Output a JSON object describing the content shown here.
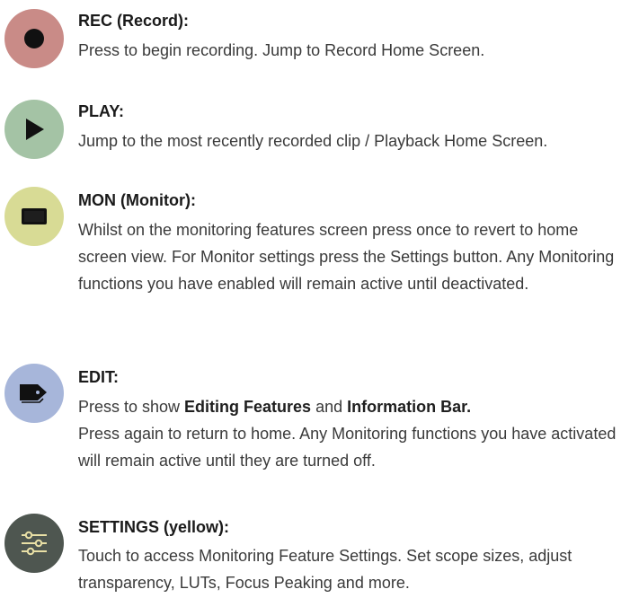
{
  "colors": {
    "rec_button": "#c98b87",
    "play_button": "#a4c3a5",
    "mon_button": "#d8db95",
    "edit_button": "#a7b6da",
    "settings_button": "#4e5650",
    "icon_dark": "#111111",
    "icon_light": "#e9e0a6"
  },
  "items": [
    {
      "icon": "record-icon",
      "title": "REC (Record):",
      "lines": [
        "Press to begin recording. Jump to Record Home Screen."
      ]
    },
    {
      "icon": "play-icon",
      "title": "PLAY:",
      "lines": [
        "Jump to the most recently recorded clip / Playback Home Screen."
      ]
    },
    {
      "icon": "monitor-icon",
      "title": "MON (Monitor):",
      "text": "Whilst on the monitoring features screen press once to revert to home screen view. For Monitor settings press the Settings button. Any Monitoring functions you have enabled will remain active until deactivated."
    },
    {
      "icon": "tag-icon",
      "title": "EDIT:",
      "line1_pre": "Press to show ",
      "line1_bold1": "Editing Features",
      "line1_mid": " and ",
      "line1_bold2": "Information Bar.",
      "text": "Press again to return to home. Any Monitoring functions you have activated will remain active until they are turned off."
    },
    {
      "icon": "sliders-icon",
      "title": "SETTINGS (yellow):",
      "text": "Touch to access Monitoring Feature Settings. Set scope sizes, adjust transparency, LUTs, Focus Peaking and more."
    }
  ]
}
